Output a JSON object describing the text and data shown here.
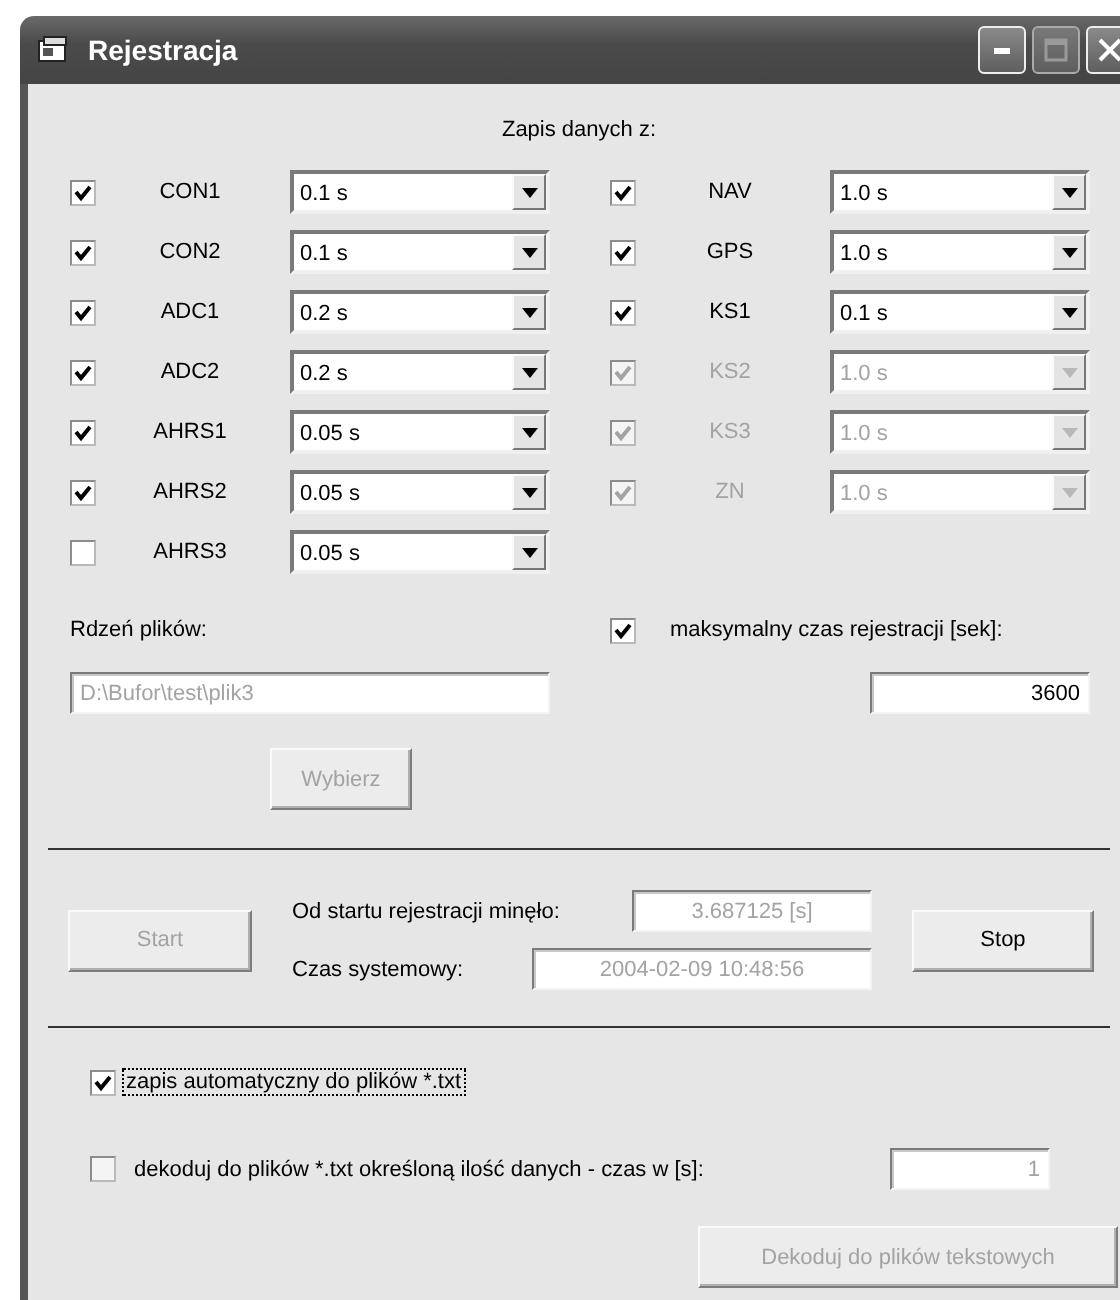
{
  "window": {
    "title": "Rejestracja",
    "maximize_disabled": true
  },
  "section_title": "Zapis danych z:",
  "channels_left": [
    {
      "name": "CON1",
      "checked": true,
      "disabled": false,
      "interval": "0.1 s"
    },
    {
      "name": "CON2",
      "checked": true,
      "disabled": false,
      "interval": "0.1 s"
    },
    {
      "name": "ADC1",
      "checked": true,
      "disabled": false,
      "interval": "0.2 s"
    },
    {
      "name": "ADC2",
      "checked": true,
      "disabled": false,
      "interval": "0.2 s"
    },
    {
      "name": "AHRS1",
      "checked": true,
      "disabled": false,
      "interval": "0.05 s"
    },
    {
      "name": "AHRS2",
      "checked": true,
      "disabled": false,
      "interval": "0.05 s"
    },
    {
      "name": "AHRS3",
      "checked": false,
      "disabled": false,
      "interval": "0.05 s"
    }
  ],
  "channels_right": [
    {
      "name": "NAV",
      "checked": true,
      "disabled": false,
      "interval": "1.0 s"
    },
    {
      "name": "GPS",
      "checked": true,
      "disabled": false,
      "interval": "1.0 s"
    },
    {
      "name": "KS1",
      "checked": true,
      "disabled": false,
      "interval": "0.1 s"
    },
    {
      "name": "KS2",
      "checked": true,
      "disabled": true,
      "interval": "1.0 s"
    },
    {
      "name": "KS3",
      "checked": true,
      "disabled": true,
      "interval": "1.0 s"
    },
    {
      "name": "ZN",
      "checked": true,
      "disabled": true,
      "interval": "1.0 s"
    }
  ],
  "file_core": {
    "label": "Rdzeń plików:",
    "value": "D:\\Bufor\\test\\plik3",
    "disabled": true
  },
  "choose_button": {
    "label": "Wybierz",
    "disabled": true
  },
  "max_time": {
    "label": "maksymalny czas rejestracji [sek]:",
    "checked": true,
    "value": "3600",
    "disabled": false
  },
  "start_button": {
    "label": "Start",
    "disabled": true
  },
  "elapsed": {
    "label": "Od startu rejestracji minęło:",
    "value": "3.687125 [s]",
    "disabled": true
  },
  "system_time": {
    "label": "Czas systemowy:",
    "value": "2004-02-09 10:48:56",
    "disabled": true
  },
  "stop_button": {
    "label": "Stop",
    "disabled": false
  },
  "auto_save": {
    "label": "zapis automatyczny do plików *.txt",
    "checked": true,
    "focused": true
  },
  "decode": {
    "label": "dekoduj do plików *.txt określoną ilość danych - czas w [s]:",
    "checked": false,
    "value": "1",
    "disabled": true
  },
  "decode_button": {
    "label": "Dekoduj do plików tekstowych",
    "disabled": true
  }
}
